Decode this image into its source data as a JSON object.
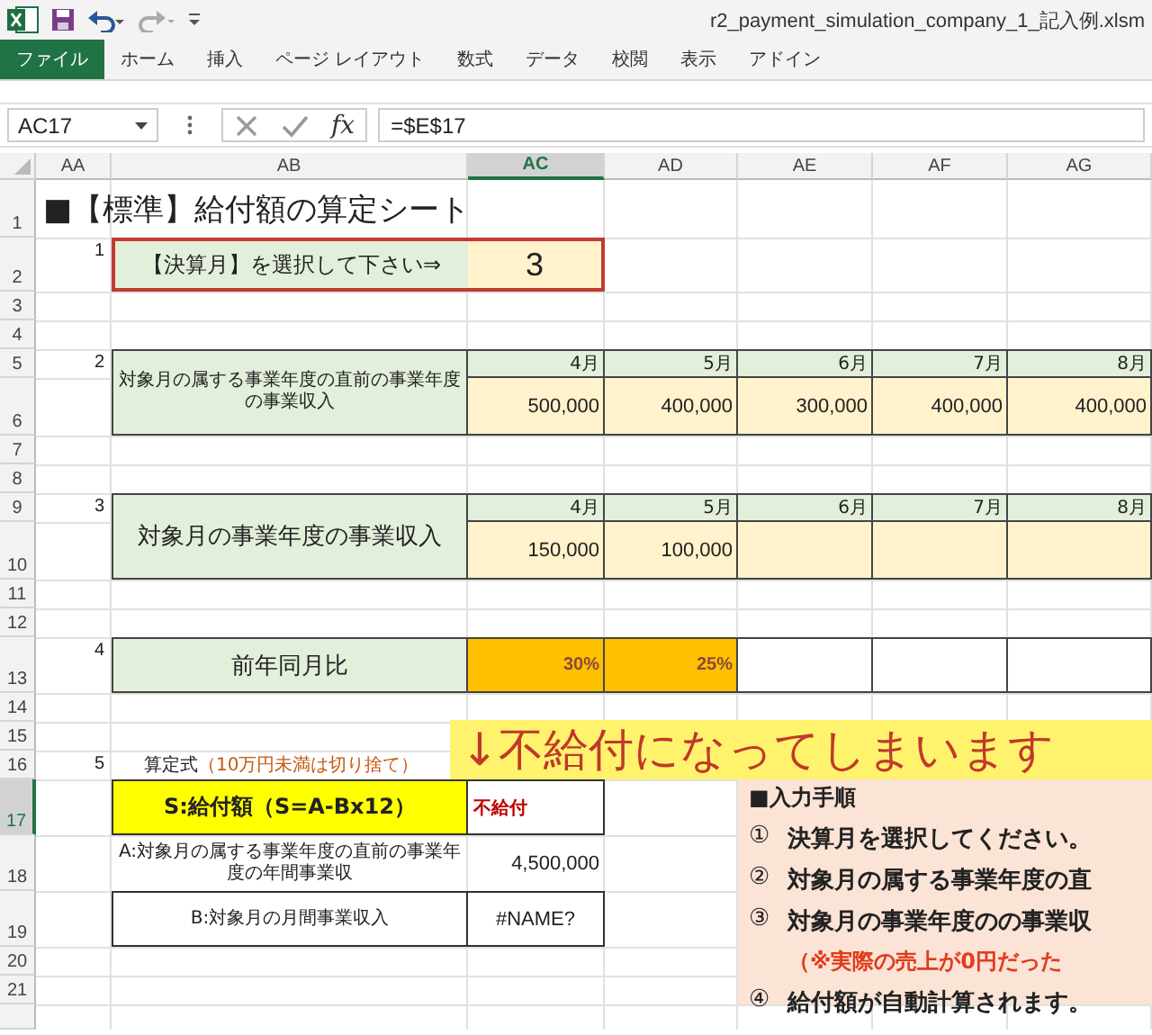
{
  "title_bar": {
    "filename": "r2_payment_simulation_company_1_記入例.xlsm"
  },
  "ribbon_tabs": [
    {
      "label": "ファイル",
      "selected": true
    },
    {
      "label": "ホーム",
      "selected": false
    },
    {
      "label": "挿入",
      "selected": false
    },
    {
      "label": "ページ レイアウト",
      "selected": false
    },
    {
      "label": "数式",
      "selected": false
    },
    {
      "label": "データ",
      "selected": false
    },
    {
      "label": "校閲",
      "selected": false
    },
    {
      "label": "表示",
      "selected": false
    },
    {
      "label": "アドイン",
      "selected": false
    }
  ],
  "formula_bar": {
    "name_box": "AC17",
    "fx": "fx",
    "formula": "=$E$17"
  },
  "columns": [
    {
      "label": "AA",
      "selected": false
    },
    {
      "label": "AB",
      "selected": false
    },
    {
      "label": "AC",
      "selected": true
    },
    {
      "label": "AD",
      "selected": false
    },
    {
      "label": "AE",
      "selected": false
    },
    {
      "label": "AF",
      "selected": false
    },
    {
      "label": "AG",
      "selected": false
    }
  ],
  "rows": [
    {
      "label": "1",
      "selected": false
    },
    {
      "label": "2",
      "selected": false
    },
    {
      "label": "3",
      "selected": false
    },
    {
      "label": "4",
      "selected": false
    },
    {
      "label": "5",
      "selected": false
    },
    {
      "label": "6",
      "selected": false
    },
    {
      "label": "7",
      "selected": false
    },
    {
      "label": "8",
      "selected": false
    },
    {
      "label": "9",
      "selected": false
    },
    {
      "label": "10",
      "selected": false
    },
    {
      "label": "11",
      "selected": false
    },
    {
      "label": "12",
      "selected": false
    },
    {
      "label": "13",
      "selected": false
    },
    {
      "label": "14",
      "selected": false
    },
    {
      "label": "15",
      "selected": false
    },
    {
      "label": "16",
      "selected": false
    },
    {
      "label": "17",
      "selected": true
    },
    {
      "label": "18",
      "selected": false
    },
    {
      "label": "19",
      "selected": false
    },
    {
      "label": "20",
      "selected": false
    },
    {
      "label": "21",
      "selected": false
    }
  ],
  "sheet": {
    "title": "■【標準】給付額の算定シート",
    "step_1": {
      "number": "1",
      "label": "【決算月】を選択して下さい⇒",
      "value": "3"
    },
    "step_2": {
      "number": "2",
      "label": "対象月の属する事業年度の直前の事業年度の事業収入",
      "months": [
        {
          "month": "4月",
          "value": "500,000"
        },
        {
          "month": "5月",
          "value": "400,000"
        },
        {
          "month": "6月",
          "value": "300,000"
        },
        {
          "month": "7月",
          "value": "400,000"
        },
        {
          "month": "8月",
          "value": "400,000"
        }
      ]
    },
    "step_3": {
      "number": "3",
      "label": "対象月の事業年度の事業収入",
      "months": [
        {
          "month": "4月",
          "value": "150,000"
        },
        {
          "month": "5月",
          "value": "100,000"
        },
        {
          "month": "6月"
        },
        {
          "month": "7月"
        },
        {
          "month": "8月"
        }
      ]
    },
    "step_4": {
      "number": "4",
      "label": "前年同月比",
      "cells": [
        {
          "value": "30%",
          "highlighted": true
        },
        {
          "value": "25%",
          "highlighted": true
        },
        {
          "highlighted": false
        },
        {
          "highlighted": false
        },
        {
          "highlighted": false
        }
      ]
    },
    "step_5": {
      "number": "5",
      "formula_label": "算定式",
      "formula_note": "（10万円未満は切り捨て）",
      "lines": [
        {
          "kind": "result",
          "label": "S:給付額（S=A-Bx12）",
          "value": "不給付"
        },
        {
          "kind": "plain",
          "label": "A:対象月の属する事業年度の直前の事業年度の年間事業収",
          "value": "4,500,000"
        },
        {
          "kind": "boxed",
          "label": "B:対象月の月間事業収入",
          "value": "#NAME?"
        }
      ]
    }
  },
  "annotation": {
    "text": "↓不給付になってしまいます"
  },
  "instructions": {
    "title": "■入力手順",
    "items": [
      {
        "kind": "step",
        "marker": "①",
        "text": "決算月を選択してください。"
      },
      {
        "kind": "step",
        "marker": "②",
        "text": "対象月の属する事業年度の直"
      },
      {
        "kind": "step",
        "marker": "③",
        "text": "対象月の事業年度のの事業収"
      },
      {
        "kind": "note",
        "text": "（※実際の売上が0円だった"
      },
      {
        "kind": "step",
        "marker": "④",
        "text": "給付額が自動計算されます。"
      }
    ]
  }
}
